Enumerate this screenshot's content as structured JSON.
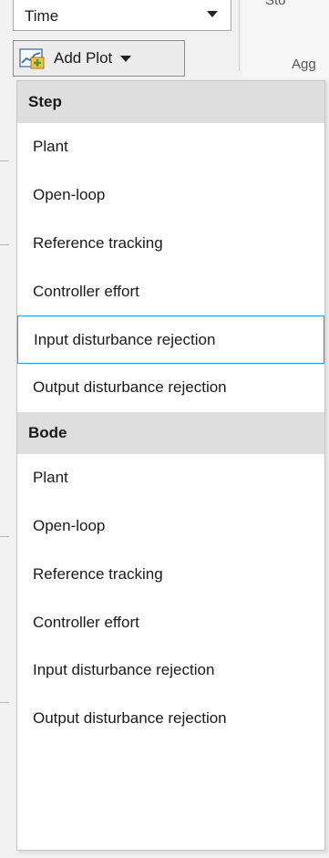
{
  "toolbar": {
    "time_select_value": "Time",
    "add_plot_label": "Add Plot",
    "partial_label_top": "Sto",
    "partial_label_mid": "Agg"
  },
  "menu": {
    "sections": [
      {
        "header": "Step",
        "items": [
          "Plant",
          "Open-loop",
          "Reference tracking",
          "Controller effort",
          "Input disturbance rejection",
          "Output disturbance rejection"
        ]
      },
      {
        "header": "Bode",
        "items": [
          "Plant",
          "Open-loop",
          "Reference tracking",
          "Controller effort",
          "Input disturbance rejection",
          "Output disturbance rejection"
        ]
      }
    ],
    "highlighted_item": "Input disturbance rejection"
  },
  "colors": {
    "highlight_border": "#2f9ae0",
    "header_bg": "#dedede"
  },
  "icons": {
    "add_plot": "add-plot-icon",
    "dropdown": "chevron-down-icon"
  }
}
